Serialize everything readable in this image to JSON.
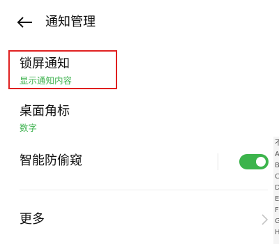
{
  "header": {
    "title": "通知管理",
    "back_icon": "back-arrow-icon"
  },
  "settings": [
    {
      "key": "lock_screen",
      "title": "锁屏通知",
      "subtitle": "显示通知内容"
    },
    {
      "key": "badge",
      "title": "桌面角标",
      "subtitle": "数字"
    },
    {
      "key": "privacy",
      "title": "智能防偷窥",
      "toggle_on": true
    },
    {
      "key": "more",
      "title": "更多",
      "icon": "chevron-right-icon"
    }
  ],
  "edge_strip_chars": [
    "不",
    "A",
    "B",
    "C",
    "D",
    "E",
    "F",
    "G",
    "H"
  ],
  "colors": {
    "accent_green": "#3cb44c",
    "subtitle_green": "#3eb24f",
    "highlight_red": "#e02020"
  }
}
